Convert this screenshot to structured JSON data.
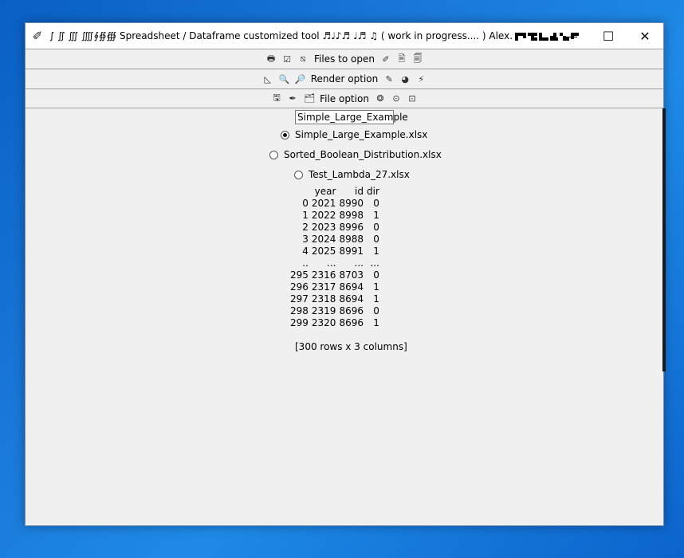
{
  "window": {
    "title": "∫ ∬ ∭ ⨌∮∯∰ Spreadsheet / Dataframe customized tool ♬♩♪♬ ♩♬ ♫ ( work in progress.... ) Alex.",
    "controls": {
      "minimize": "—",
      "maximize": "☐",
      "close": "✕"
    }
  },
  "toolbars": [
    {
      "icons_left": [
        "🖶",
        "☑",
        "⧅"
      ],
      "label": "Files to open",
      "icons_right": [
        "✐",
        "🖹",
        "🗐"
      ]
    },
    {
      "icons_left": [
        "◺",
        "🔍",
        "🔎"
      ],
      "label": "Render option",
      "icons_right": [
        "✎",
        "◕",
        "⚡"
      ]
    },
    {
      "icons_left": [
        "🖫",
        "✒",
        "🗂"
      ],
      "label": "File option",
      "icons_right": [
        "❂",
        "⊙",
        "⊡"
      ]
    }
  ],
  "file_entry": {
    "value": "Simple_Large_Example"
  },
  "files": [
    {
      "label": "Simple_Large_Example.xlsx",
      "selected": true
    },
    {
      "label": "Sorted_Boolean_Distribution.xlsx",
      "selected": false
    },
    {
      "label": "Test_Lambda_27.xlsx",
      "selected": false
    }
  ],
  "dataframe": {
    "columns": [
      "",
      "year",
      "id",
      "dir"
    ],
    "rows": [
      [
        "0",
        "2021",
        "8990",
        "0"
      ],
      [
        "1",
        "2022",
        "8998",
        "1"
      ],
      [
        "2",
        "2023",
        "8996",
        "0"
      ],
      [
        "3",
        "2024",
        "8988",
        "0"
      ],
      [
        "4",
        "2025",
        "8991",
        "1"
      ],
      [
        "..",
        "...",
        "...",
        "..."
      ],
      [
        "295",
        "2316",
        "8703",
        "0"
      ],
      [
        "296",
        "2317",
        "8694",
        "1"
      ],
      [
        "297",
        "2318",
        "8694",
        "1"
      ],
      [
        "298",
        "2319",
        "8696",
        "0"
      ],
      [
        "299",
        "2320",
        "8696",
        "1"
      ]
    ],
    "summary": "[300 rows x 3 columns]"
  }
}
